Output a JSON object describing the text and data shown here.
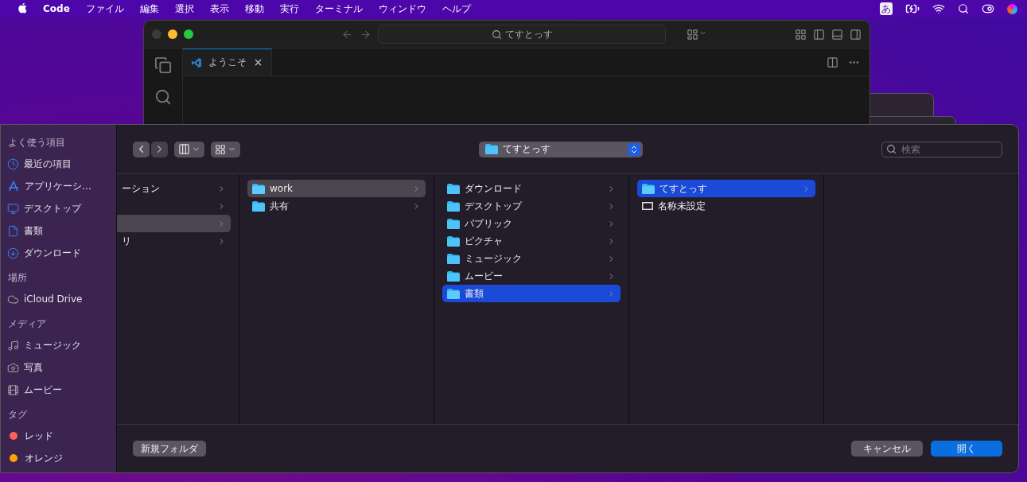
{
  "menubar": {
    "app_name": "Code",
    "menus": [
      "ファイル",
      "編集",
      "選択",
      "表示",
      "移動",
      "実行",
      "ターミナル",
      "ウィンドウ",
      "ヘルプ"
    ],
    "input_method": "あ"
  },
  "editor_window": {
    "search": "てすとっす",
    "tabs": [
      {
        "label": "ようこそ",
        "selected": true
      }
    ]
  },
  "open_dialog": {
    "sidebar": [
      {
        "title": "よく使う項目",
        "items": [
          {
            "label": "最近の項目",
            "kind": "clock"
          },
          {
            "label": "アプリケーシ…",
            "kind": "apps"
          },
          {
            "label": "デスクトップ",
            "kind": "desktop"
          },
          {
            "label": "書類",
            "kind": "document"
          },
          {
            "label": "ダウンロード",
            "kind": "download"
          }
        ]
      },
      {
        "title": "場所",
        "items": [
          {
            "label": "iCloud Drive",
            "kind": "cloud"
          }
        ]
      },
      {
        "title": "メディア",
        "items": [
          {
            "label": "ミュージック",
            "kind": "music"
          },
          {
            "label": "写真",
            "kind": "camera"
          },
          {
            "label": "ムービー",
            "kind": "film"
          }
        ]
      },
      {
        "title": "タグ",
        "items": [
          {
            "label": "レッド",
            "kind": "tag",
            "color": "#ff5f57"
          },
          {
            "label": "オレンジ",
            "kind": "tag",
            "color": "#ff9f0a"
          }
        ]
      }
    ],
    "location": "てすとっす",
    "search": {
      "placeholder": "検索"
    },
    "columns": [
      {
        "active": false,
        "items": [
          {
            "label": "ーション",
            "kind": "none",
            "selected": false
          },
          {
            "kind": "none",
            "selected": false
          },
          {
            "kind": "none",
            "selected": true
          },
          {
            "label": "リ",
            "kind": "none",
            "selected": false
          }
        ]
      },
      {
        "active": false,
        "items": [
          {
            "label": "work",
            "kind": "folder",
            "selected": true
          },
          {
            "label": "共有",
            "kind": "folder",
            "selected": false
          }
        ]
      },
      {
        "active": true,
        "items": [
          {
            "label": "ダウンロード",
            "kind": "folder",
            "selected": false
          },
          {
            "label": "デスクトップ",
            "kind": "folder",
            "selected": false
          },
          {
            "label": "パブリック",
            "kind": "folder",
            "selected": false
          },
          {
            "label": "ピクチャ",
            "kind": "folder",
            "selected": false
          },
          {
            "label": "ミュージック",
            "kind": "folder",
            "selected": false
          },
          {
            "label": "ムービー",
            "kind": "folder",
            "selected": false
          },
          {
            "label": "書類",
            "kind": "folder",
            "selected": true
          }
        ]
      },
      {
        "active": true,
        "items": [
          {
            "label": "てすとっす",
            "kind": "folder",
            "selected": true
          },
          {
            "label": "名称未設定",
            "kind": "file",
            "selected": false
          }
        ]
      }
    ],
    "buttons": {
      "new_folder": "新規フォルダ",
      "cancel": "キャンセル",
      "open": "開く"
    }
  }
}
